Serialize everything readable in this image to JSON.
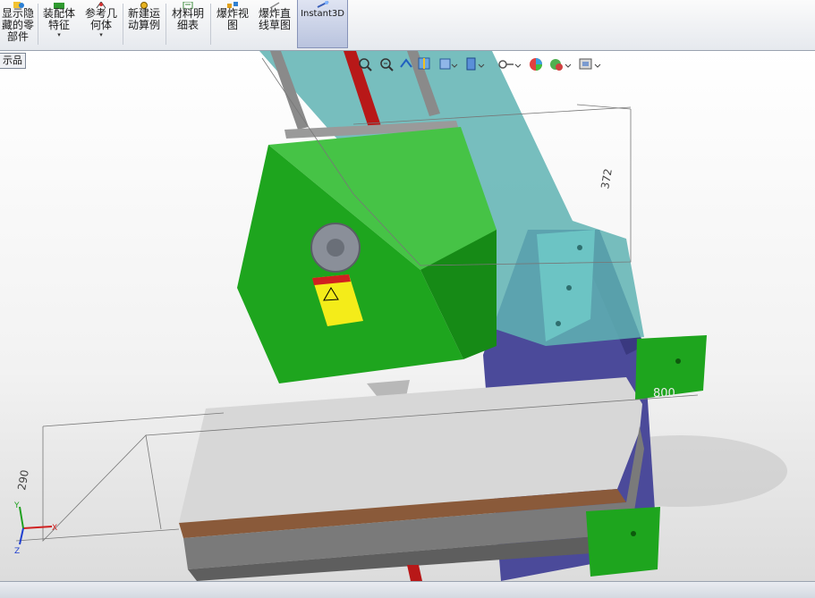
{
  "toolbar": {
    "buttons": [
      {
        "id": "show-hidden",
        "label": "显示隐\n藏的零\n部件",
        "dropdown": false
      },
      {
        "id": "assembly-feature",
        "label": "装配体\n特征",
        "dropdown": true
      },
      {
        "id": "reference-geometry",
        "label": "参考几\n何体",
        "dropdown": true
      },
      {
        "id": "new-motion-study",
        "label": "新建运\n动算例",
        "dropdown": false
      },
      {
        "id": "bill-of-materials",
        "label": "材料明\n细表",
        "dropdown": false
      },
      {
        "id": "exploded-view",
        "label": "爆炸视\n图",
        "dropdown": false
      },
      {
        "id": "explode-line-sketch",
        "label": "爆炸直\n线草图",
        "dropdown": false
      },
      {
        "id": "instant3d",
        "label": "Instant3D",
        "dropdown": false
      }
    ],
    "dropdown_caret": "▾"
  },
  "tree_tab": {
    "label": "示品"
  },
  "view_toolbar": {
    "icons": [
      "zoom-to-fit-icon",
      "zoom-area-icon",
      "previous-view-icon",
      "section-view-icon",
      "view-orientation-icon",
      "display-style-icon",
      "hide-show-items-icon",
      "edit-appearance-icon",
      "apply-scene-icon",
      "view-settings-icon"
    ]
  },
  "dimensions": {
    "height": "372",
    "width": "800",
    "depth": "290"
  },
  "triad": {
    "x": "X",
    "y": "Y",
    "z": "Z"
  },
  "colors": {
    "spindle_green": "#1ea51e",
    "frame_teal": "#5fb3b3",
    "base_blue": "#4b4a9a",
    "table_gray": "#d7d7d7",
    "leadscrew_red": "#b81818",
    "warning_yellow": "#f4ec19"
  }
}
